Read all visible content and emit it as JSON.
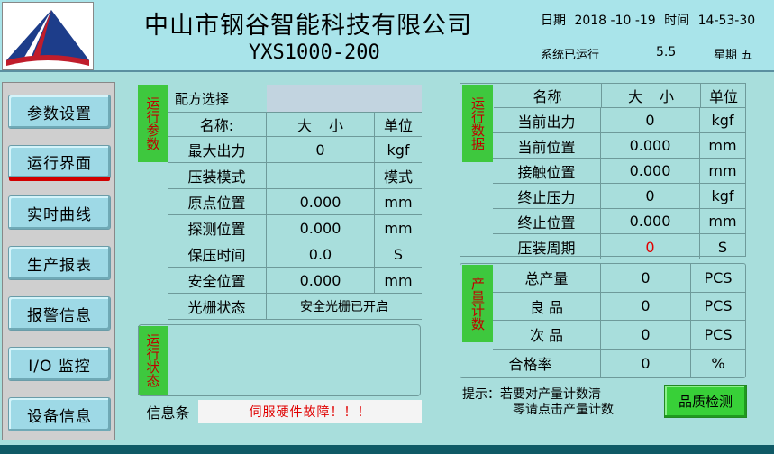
{
  "header": {
    "company": "中山市钢谷智能科技有限公司",
    "model": "YXS1000-200",
    "date_label": "日期",
    "date_value": "2018 -10 -19",
    "time_label": "时间",
    "time_value": "14-53-30",
    "run_label": "系统已运行",
    "run_value": "5.5",
    "weekday": "星期 五"
  },
  "sidebar": {
    "items": [
      {
        "label": "参数设置"
      },
      {
        "label": "运行界面"
      },
      {
        "label": "实时曲线"
      },
      {
        "label": "生产报表"
      },
      {
        "label": "报警信息"
      },
      {
        "label": "I/O 监控"
      },
      {
        "label": "设备信息"
      }
    ],
    "active_index": 1
  },
  "params": {
    "tag": "运行参数",
    "recipe_label": "配方选择",
    "recipe_value": "",
    "headers": [
      "名称:",
      "大 小",
      "单位"
    ],
    "rows": [
      {
        "name": "最大出力",
        "value": "0",
        "unit": "kgf"
      },
      {
        "name": "压装模式",
        "value": "",
        "unit": "模式"
      },
      {
        "name": "原点位置",
        "value": "0.000",
        "unit": "mm"
      },
      {
        "name": "探测位置",
        "value": "0.000",
        "unit": "mm"
      },
      {
        "name": "保压时间",
        "value": "0.0",
        "unit": "S"
      },
      {
        "name": "安全位置",
        "value": "0.000",
        "unit": "mm"
      },
      {
        "name": "光栅状态",
        "value": "安全光栅已开启",
        "unit": ""
      }
    ]
  },
  "run_state": {
    "tag": "运行状态"
  },
  "info_bar": {
    "label": "信息条",
    "message": "伺服硬件故障！！！"
  },
  "run_data": {
    "tag": "运行数据",
    "headers": [
      "名称",
      "大 小",
      "单位"
    ],
    "rows": [
      {
        "name": "当前出力",
        "value": "0",
        "unit": "kgf"
      },
      {
        "name": "当前位置",
        "value": "0.000",
        "unit": "mm"
      },
      {
        "name": "接触位置",
        "value": "0.000",
        "unit": "mm"
      },
      {
        "name": "终止压力",
        "value": "0",
        "unit": "kgf"
      },
      {
        "name": "终止位置",
        "value": "0.000",
        "unit": "mm"
      },
      {
        "name": "压装周期",
        "value": "0",
        "unit": "S"
      }
    ]
  },
  "counts": {
    "tag": "产量计数",
    "rows": [
      {
        "name": "总产量",
        "value": "0",
        "unit": "PCS"
      },
      {
        "name": "良 品",
        "value": "0",
        "unit": "PCS"
      },
      {
        "name": "次 品",
        "value": "0",
        "unit": "PCS"
      },
      {
        "name": "合格率",
        "value": "0",
        "unit": "%"
      }
    ]
  },
  "tip": {
    "line1": "提示：若要对产量计数清",
    "line2": "零请点击产量计数"
  },
  "qc_button": {
    "label": "品质检测"
  },
  "colors": {
    "accent_green": "#3ec83e",
    "alert_red": "#e00000",
    "header_bg": "#a9e4ea",
    "body_bg": "#a8dedc"
  }
}
